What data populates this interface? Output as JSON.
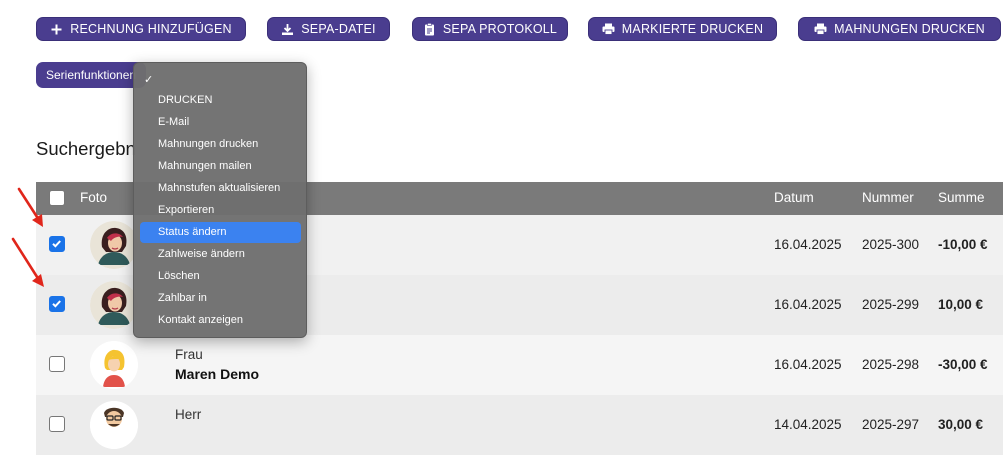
{
  "toolbar": {
    "add_invoice": "RECHNUNG HINZUFÜGEN",
    "sepa_file": "SEPA-DATEI",
    "sepa_log": "SEPA PROTOKOLL",
    "print_marked": "MARKIERTE DRUCKEN",
    "print_reminders": "MAHNUNGEN DRUCKEN"
  },
  "serial_function": "Serienfunktionen",
  "results_heading": "Suchergebnisse",
  "table": {
    "headers": {
      "photo": "Foto",
      "date": "Datum",
      "number": "Nummer",
      "sum": "Summe"
    },
    "rows": [
      {
        "checked": true,
        "salutation": "",
        "name": "",
        "date": "16.04.2025",
        "number": "2025-300",
        "sum": "-10,00 €"
      },
      {
        "checked": true,
        "salutation": "",
        "name": "",
        "date": "16.04.2025",
        "number": "2025-299",
        "sum": "10,00 €"
      },
      {
        "checked": false,
        "salutation": "Frau",
        "name": "Maren Demo",
        "date": "16.04.2025",
        "number": "2025-298",
        "sum": "-30,00 €"
      },
      {
        "checked": false,
        "salutation": "Herr",
        "name": "",
        "date": "14.04.2025",
        "number": "2025-297",
        "sum": "30,00 €"
      }
    ]
  },
  "dropdown": {
    "checkmark": "✓",
    "items": [
      "DRUCKEN",
      "E-Mail",
      "Mahnungen drucken",
      "Mahnungen mailen",
      "Mahnstufen aktualisieren",
      "Exportieren",
      "Status ändern",
      "Zahlweise ändern",
      "Löschen",
      "Zahlbar in",
      "Kontakt anzeigen"
    ],
    "selected": "Status ändern"
  },
  "colors": {
    "button": "#4a3d8f",
    "header": "#7a7a7a",
    "checkbox": "#1a73e8",
    "menu_highlight": "#3b82f0",
    "arrow": "#e0261b"
  }
}
